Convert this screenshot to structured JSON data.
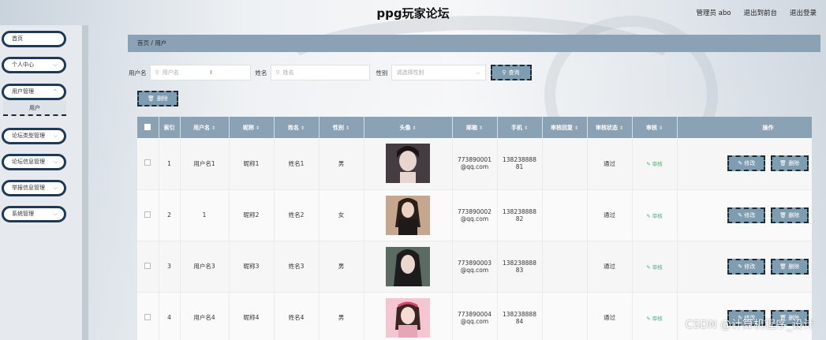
{
  "header": {
    "title": "ppg玩家论坛",
    "admin": "管理员 abo",
    "to_front": "退出到前台",
    "logout": "退出登录"
  },
  "sidebar": {
    "items": [
      {
        "label": "首页",
        "chevron": false
      },
      {
        "label": "个人中心",
        "chevron": true
      },
      {
        "label": "用户管理",
        "chevron": true
      },
      {
        "label": "论坛类型管理",
        "chevron": true
      },
      {
        "label": "论坛信息管理",
        "chevron": true
      },
      {
        "label": "举报信息管理",
        "chevron": true
      },
      {
        "label": "系统管理",
        "chevron": true
      }
    ],
    "sub_item": "用户"
  },
  "breadcrumb": {
    "home": "首页",
    "sep": "/",
    "current": "用户"
  },
  "search": {
    "username_label": "用户名",
    "username_placeholder": "用户名",
    "name_label": "姓名",
    "name_placeholder": "姓名",
    "gender_label": "性别",
    "gender_placeholder": "请选择性别",
    "search_button": "查询"
  },
  "toolbar": {
    "delete_button": "删除"
  },
  "table": {
    "columns": [
      "索引",
      "用户名",
      "昵称",
      "姓名",
      "性别",
      "头像",
      "邮箱",
      "手机",
      "审核回复",
      "审核状态",
      "审核",
      "操作"
    ],
    "rows": [
      {
        "index": "1",
        "username": "用户名1",
        "nickname": "昵称1",
        "name": "姓名1",
        "gender": "男",
        "email_1": "773890001",
        "email_2": "@qq.com",
        "phone_1": "138238888",
        "phone_2": "81",
        "reply": "",
        "status": "通过",
        "audit": "审核",
        "avatar_color": "#2a2226"
      },
      {
        "index": "2",
        "username": "1",
        "nickname": "昵称2",
        "name": "姓名2",
        "gender": "女",
        "email_1": "773890002",
        "email_2": "@qq.com",
        "phone_1": "138238888",
        "phone_2": "82",
        "reply": "",
        "status": "通过",
        "audit": "审核",
        "avatar_color": "#8c6a55"
      },
      {
        "index": "3",
        "username": "用户名3",
        "nickname": "昵称3",
        "name": "姓名3",
        "gender": "男",
        "email_1": "773890003",
        "email_2": "@qq.com",
        "phone_1": "138238888",
        "phone_2": "83",
        "reply": "",
        "status": "通过",
        "audit": "审核",
        "avatar_color": "#3f4f48"
      },
      {
        "index": "4",
        "username": "用户名4",
        "nickname": "昵称4",
        "name": "姓名4",
        "gender": "男",
        "email_1": "773890004",
        "email_2": "@qq.com",
        "phone_1": "138238888",
        "phone_2": "84",
        "reply": "",
        "status": "通过",
        "audit": "审核",
        "avatar_color": "#d98fa3"
      }
    ],
    "edit_button": "修改",
    "delete_button": "删除"
  },
  "watermark": "CSDN @计算机程序_设计"
}
